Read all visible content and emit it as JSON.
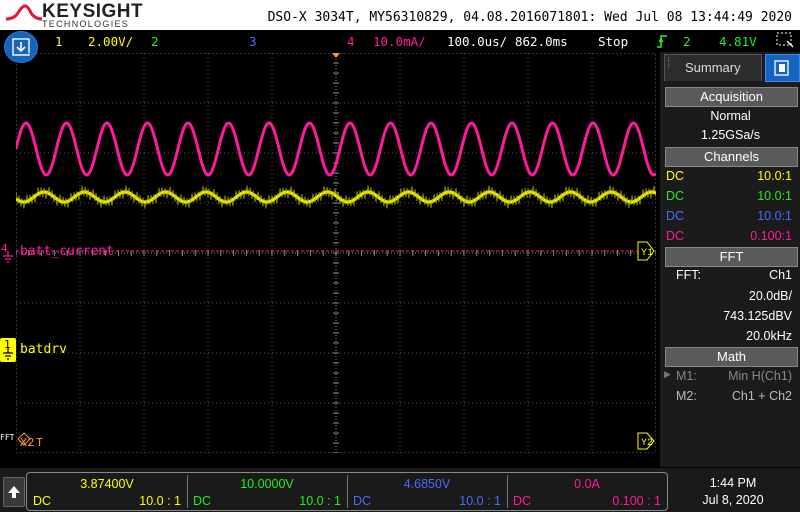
{
  "header": {
    "brand": "KEYSIGHT",
    "brand_sub": "TECHNOLOGIES",
    "title": "DSO-X 3034T, MY56310829, 04.08.2016071801: Wed Jul 08 13:44:49 2020"
  },
  "status": {
    "ch1_num": "1",
    "ch1_scale": "2.00V/",
    "ch2_num": "2",
    "ch3_num": "3",
    "ch4_num": "4",
    "ch4_scale": "10.0mA/",
    "timebase": "100.0us/",
    "delay": "862.0ms",
    "run_state": "Stop",
    "trigger_source": "2",
    "trigger_level": "4.81V"
  },
  "plot": {
    "label_ch4": "batt_current",
    "label_ch1": "batdrv",
    "marker_ch4": "4",
    "marker_ch1": "1",
    "marker_y1": "Y1",
    "marker_y2": "Y2",
    "marker_x2": "X2",
    "marker_t": "T",
    "marker_fft": "FFT"
  },
  "panel": {
    "tab_label": "Summary",
    "acq_head": "Acquisition",
    "acq_mode": "Normal",
    "acq_rate": "1.25GSa/s",
    "ch_head": "Channels",
    "channels": [
      {
        "coupling": "DC",
        "probe": "10.0:1",
        "color": "#ffff00"
      },
      {
        "coupling": "DC",
        "probe": "10.0:1",
        "color": "#22ee22"
      },
      {
        "coupling": "DC",
        "probe": "10.0:1",
        "color": "#4a6cff"
      },
      {
        "coupling": "DC",
        "probe": "0.100:1",
        "color": "#ff1a9a"
      }
    ],
    "fft_head": "FFT",
    "fft_label": "FFT:",
    "fft_source": "Ch1",
    "fft_scale": "20.0dB/",
    "fft_ref": "743.125dBV",
    "fft_span": "20.0kHz",
    "math_head": "Math",
    "m1_label": "M1:",
    "m1_value": "Min H(Ch1)",
    "m2_label": "M2:",
    "m2_value": "Ch1 + Ch2"
  },
  "footer": {
    "channels": [
      {
        "value": "3.87400V",
        "coupling": "DC",
        "probe": "10.0 : 1",
        "color": "#ffff00"
      },
      {
        "value": "10.0000V",
        "coupling": "DC",
        "probe": "10.0 : 1",
        "color": "#22ee22"
      },
      {
        "value": "4.6850V",
        "coupling": "DC",
        "probe": "10.0 : 1",
        "color": "#4a6cff"
      },
      {
        "value": "0.0A",
        "coupling": "DC",
        "probe": "0.100 : 1",
        "color": "#ff1a9a"
      }
    ],
    "time": "1:44 PM",
    "date": "Jul 8, 2020"
  },
  "colors": {
    "ch1": "#ffff00",
    "ch2": "#22ee22",
    "ch3": "#4a6cff",
    "ch4": "#ff1a9a",
    "accent": "#1565c0"
  },
  "icons": {
    "logo": "keysight-wave-logo",
    "home": "home-icon",
    "trigger": "trigger-edge-icon",
    "zoom": "dashed-box-icon",
    "up": "up-arrow-icon",
    "settings": "settings-icon",
    "ground": "ground-icon"
  }
}
